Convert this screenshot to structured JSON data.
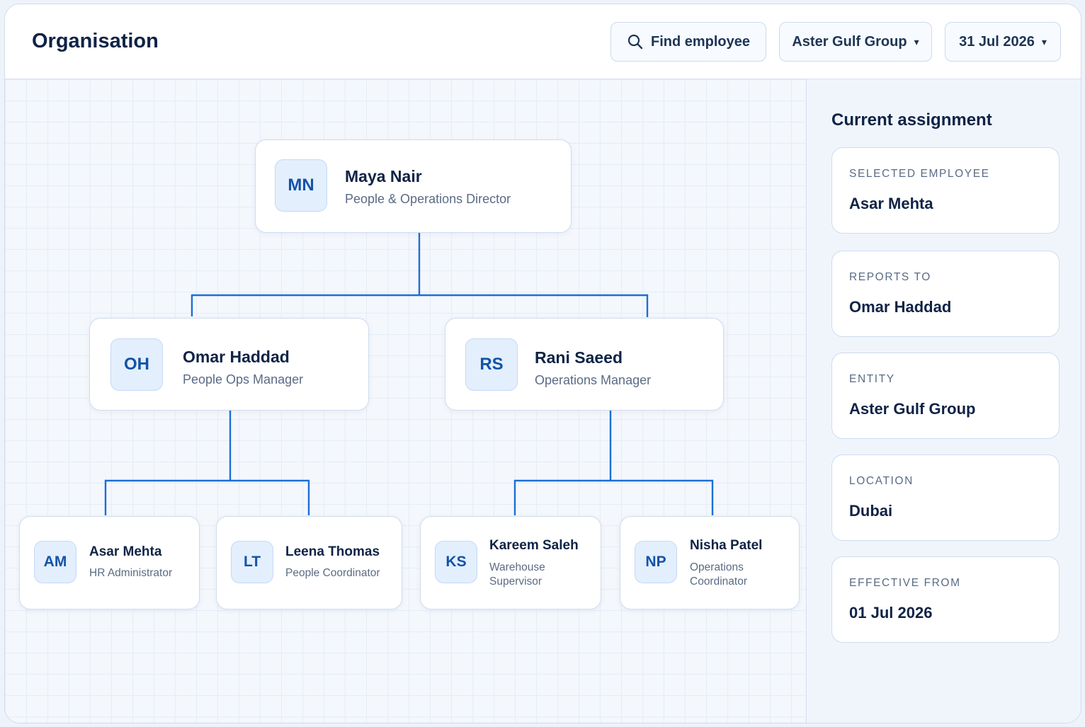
{
  "header": {
    "title": "Organisation",
    "search_label": "Find employee",
    "entity_label": "Aster Gulf Group",
    "date_label": "31 Jul 2026",
    "caret": "▾"
  },
  "org": {
    "root": {
      "initials": "MN",
      "name": "Maya Nair",
      "role": "People & Operations Director"
    },
    "managers": [
      {
        "initials": "OH",
        "name": "Omar Haddad",
        "role": "People Ops Manager"
      },
      {
        "initials": "RS",
        "name": "Rani Saeed",
        "role": "Operations Manager"
      }
    ],
    "reports": [
      {
        "initials": "AM",
        "name": "Asar Mehta",
        "role": "HR Administrator"
      },
      {
        "initials": "LT",
        "name": "Leena Thomas",
        "role": "People Coordinator"
      },
      {
        "initials": "KS",
        "name": "Kareem Saleh",
        "role": "Warehouse Supervisor"
      },
      {
        "initials": "NP",
        "name": "Nisha Patel",
        "role": "Operations Coordinator"
      }
    ]
  },
  "panel": {
    "title": "Current assignment",
    "fields": [
      {
        "label": "Selected employee",
        "value": "Asar Mehta"
      },
      {
        "label": "Reports to",
        "value": "Omar Haddad"
      },
      {
        "label": "Entity",
        "value": "Aster Gulf Group"
      },
      {
        "label": "Location",
        "value": "Dubai"
      },
      {
        "label": "Effective from",
        "value": "01 Jul 2026"
      }
    ]
  },
  "colors": {
    "accent": "#1a6fd6",
    "avatar_bg": "#e3effd",
    "title_text": "#0f2346",
    "muted_text": "#5a6b85"
  },
  "icons": {
    "search": "search-icon",
    "dropdown": "chevron-down-icon"
  }
}
